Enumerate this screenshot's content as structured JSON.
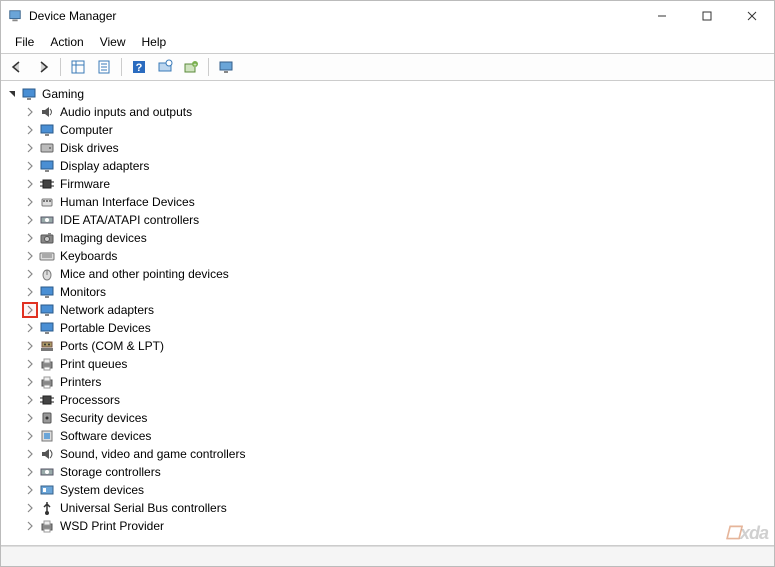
{
  "window": {
    "title": "Device Manager"
  },
  "menubar": {
    "items": [
      "File",
      "Action",
      "View",
      "Help"
    ]
  },
  "toolbar": {
    "buttons": [
      {
        "name": "back-icon"
      },
      {
        "name": "forward-icon"
      },
      {
        "sep": true
      },
      {
        "name": "show-hide-tree-icon"
      },
      {
        "name": "properties-icon"
      },
      {
        "sep": true
      },
      {
        "name": "help-icon"
      },
      {
        "name": "scan-icon"
      },
      {
        "name": "add-legacy-icon"
      },
      {
        "sep": true
      },
      {
        "name": "monitor-icon"
      }
    ]
  },
  "tree": {
    "root": {
      "label": "Gaming",
      "icon": "computer-icon",
      "expanded": true
    },
    "children": [
      {
        "label": "Audio inputs and outputs",
        "icon": "audio-icon"
      },
      {
        "label": "Computer",
        "icon": "pc-icon"
      },
      {
        "label": "Disk drives",
        "icon": "disk-icon"
      },
      {
        "label": "Display adapters",
        "icon": "display-icon"
      },
      {
        "label": "Firmware",
        "icon": "chip-icon"
      },
      {
        "label": "Human Interface Devices",
        "icon": "hid-icon"
      },
      {
        "label": "IDE ATA/ATAPI controllers",
        "icon": "ide-icon"
      },
      {
        "label": "Imaging devices",
        "icon": "camera-icon"
      },
      {
        "label": "Keyboards",
        "icon": "keyboard-icon"
      },
      {
        "label": "Mice and other pointing devices",
        "icon": "mouse-icon"
      },
      {
        "label": "Monitors",
        "icon": "monitor-icon"
      },
      {
        "label": "Network adapters",
        "icon": "network-icon",
        "highlight": true
      },
      {
        "label": "Portable Devices",
        "icon": "portable-icon"
      },
      {
        "label": "Ports (COM & LPT)",
        "icon": "port-icon"
      },
      {
        "label": "Print queues",
        "icon": "printer-icon"
      },
      {
        "label": "Printers",
        "icon": "printer-icon"
      },
      {
        "label": "Processors",
        "icon": "cpu-icon"
      },
      {
        "label": "Security devices",
        "icon": "security-icon"
      },
      {
        "label": "Software devices",
        "icon": "software-icon"
      },
      {
        "label": "Sound, video and game controllers",
        "icon": "sound-icon"
      },
      {
        "label": "Storage controllers",
        "icon": "storage-icon"
      },
      {
        "label": "System devices",
        "icon": "system-icon"
      },
      {
        "label": "Universal Serial Bus controllers",
        "icon": "usb-icon"
      },
      {
        "label": "WSD Print Provider",
        "icon": "printer-icon"
      }
    ]
  },
  "watermark": {
    "text_prefix": "",
    "text": "xda"
  }
}
